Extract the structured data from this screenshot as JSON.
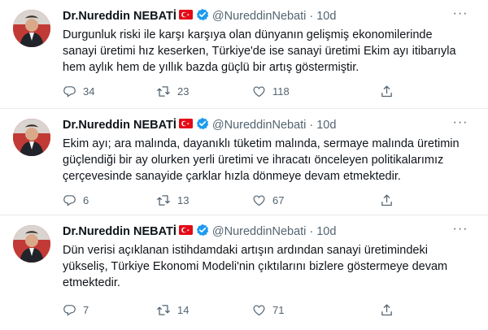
{
  "tweets": [
    {
      "author": "Dr.Nureddin NEBATİ",
      "handle": "@NureddinNebati",
      "time": "10d",
      "text": "Durgunluk riski ile karşı karşıya olan dünyanın gelişmiş ekonomilerinde\nsanayi üretimi hız keserken, Türkiye'de ise sanayi üretimi Ekim ayı itibarıyla\nhem aylık hem de yıllık bazda güçlü bir artış göstermiştir.",
      "replies": "34",
      "retweets": "23",
      "likes": "118"
    },
    {
      "author": "Dr.Nureddin NEBATİ",
      "handle": "@NureddinNebati",
      "time": "10d",
      "text": "Ekim ayı; ara malında, dayanıklı tüketim malında, sermaye malında üretimin\ngüçlendiği bir ay olurken yerli üretimi ve ihracatı önceleyen politikalarımız\nçerçevesinde sanayide çarklar hızla dönmeye devam etmektedir.",
      "replies": "6",
      "retweets": "13",
      "likes": "67"
    },
    {
      "author": "Dr.Nureddin NEBATİ",
      "handle": "@NureddinNebati",
      "time": "10d",
      "text": "Dün verisi açıklanan istihdamdaki artışın ardından sanayi üretimindeki\nyükseliş, Türkiye Ekonomi Modeli'nin çıktılarını bizlere göstermeye devam\netmektedir.",
      "replies": "7",
      "retweets": "14",
      "likes": "71"
    }
  ],
  "separator": "·",
  "more_label": "···",
  "colors": {
    "text": "#0f1419",
    "muted": "#536471",
    "verified": "#1d9bf0",
    "flag": "#e30a17",
    "divider": "#e6e9ec"
  },
  "icons": {
    "reply": "reply-icon",
    "retweet": "retweet-icon",
    "like": "heart-icon",
    "share": "share-icon",
    "verified": "verified-badge-icon",
    "flag": "turkey-flag-icon",
    "more": "more-icon"
  }
}
